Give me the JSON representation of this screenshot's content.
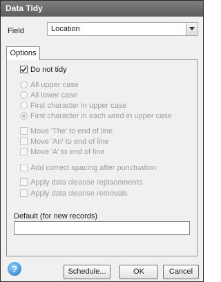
{
  "window": {
    "title": "Data Tidy"
  },
  "field": {
    "label": "Field",
    "value": "Location"
  },
  "tab": {
    "label": "Options"
  },
  "options": {
    "do_not_tidy": "Do not tidy",
    "radios": [
      "All upper case",
      "All lower case",
      "First character in upper case",
      "First character in each word in upper case"
    ],
    "moves": [
      "Move 'The' to end of line",
      "Move 'An' to end of line",
      "Move 'A' to end of line"
    ],
    "spacing": "Add correct spacing after punctuation",
    "cleanse": [
      "Apply data cleanse replacements",
      "Apply data cleanse removals"
    ],
    "default_label": "Default (for new records)",
    "default_value": ""
  },
  "buttons": {
    "schedule": "Schedule...",
    "ok": "OK",
    "cancel": "Cancel"
  },
  "icons": {
    "help": "help-icon"
  }
}
